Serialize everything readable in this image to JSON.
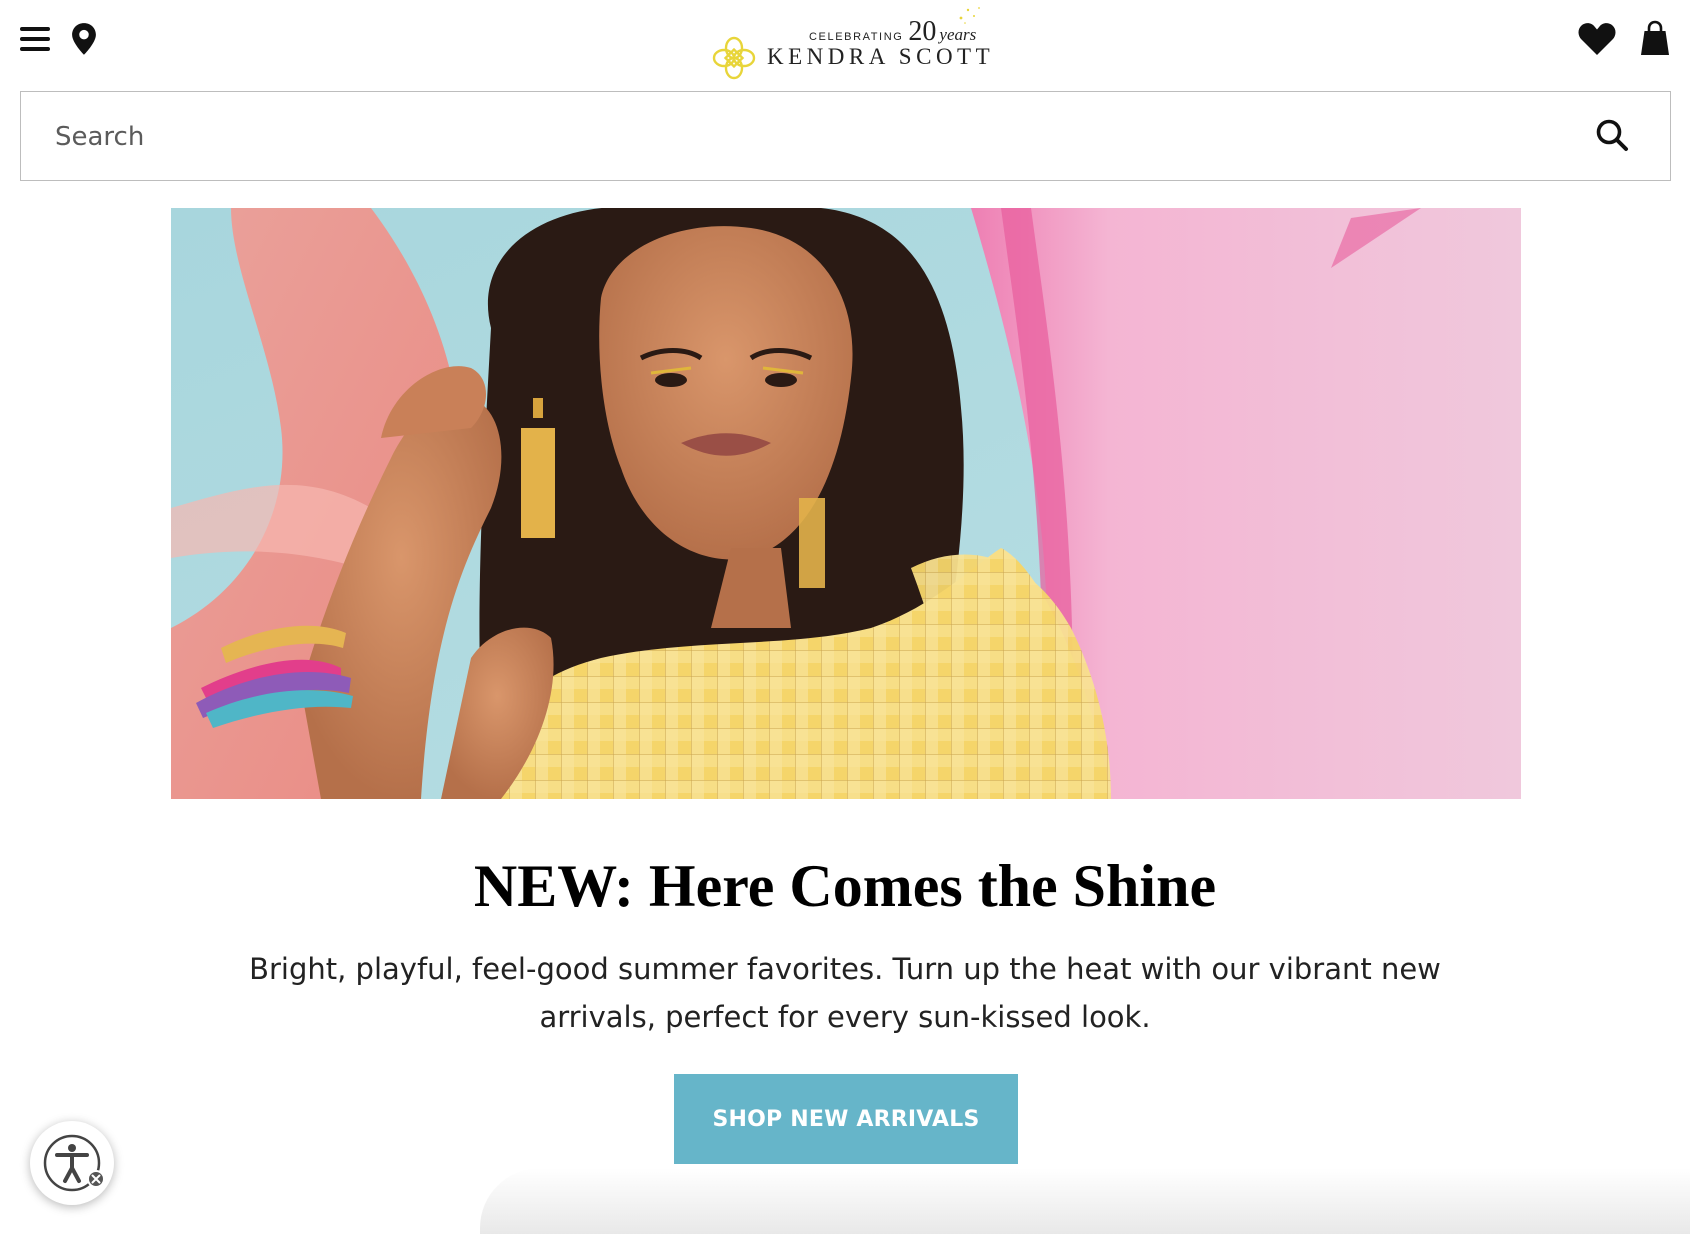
{
  "header": {
    "menu_icon": "hamburger-menu-icon",
    "location_icon": "map-pin-icon",
    "wishlist_icon": "heart-icon",
    "bag_icon": "shopping-bag-icon",
    "logo": {
      "celebrating": "CELEBRATING",
      "anniversary_number": "20",
      "years": "years",
      "brand": "KENDRA SCOTT",
      "mark_color": "#e8d53a"
    }
  },
  "search": {
    "placeholder": "Search",
    "value": "",
    "icon": "search-icon"
  },
  "hero": {
    "image": "woman-in-yellow-gingham-top-with-gold-tassel-earrings"
  },
  "promo": {
    "headline": "NEW: Here Comes the Shine",
    "description": "Bright, playful, feel-good summer favorites. Turn up the heat with our vibrant new arrivals, perfect for every sun-kissed look.",
    "cta_label": "SHOP NEW ARRIVALS",
    "cta_color": "#66b5c9"
  },
  "accessibility": {
    "icon": "accessibility-person-icon",
    "close_icon": "close-icon"
  }
}
